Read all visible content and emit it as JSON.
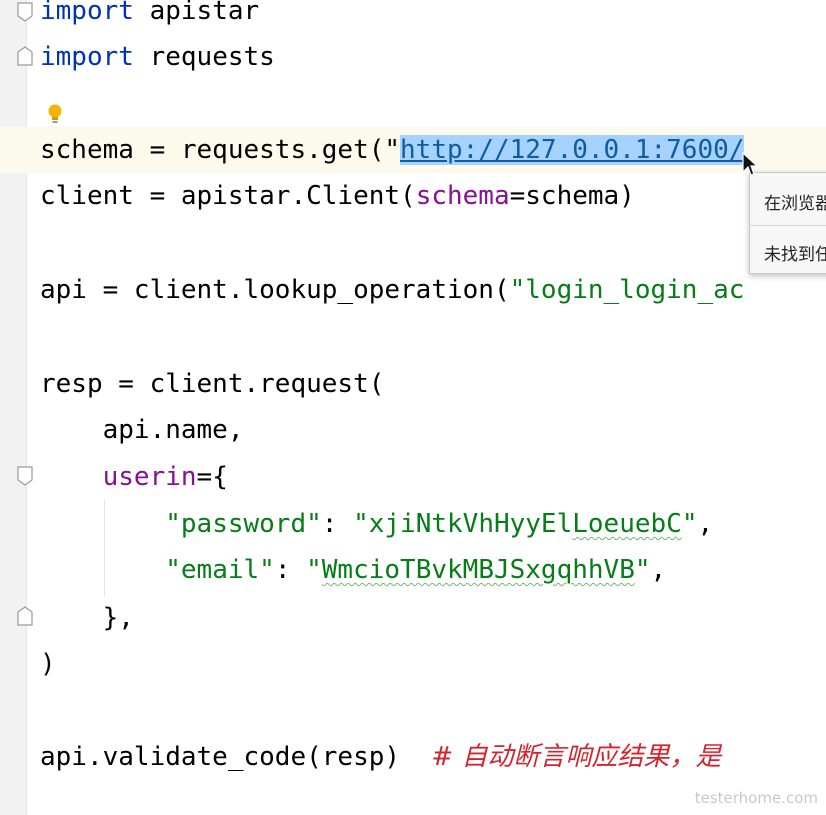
{
  "code": {
    "line1": {
      "kw": "import",
      "rest": " apistar"
    },
    "line2": {
      "kw": "import",
      "rest": " requests"
    },
    "line4": {
      "pre": "schema = requests.get(\"",
      "url": "http://127.0.0.1:7600/"
    },
    "line5": {
      "pre": "client = apistar.Client(",
      "param": "schema",
      "post": "=schema)"
    },
    "line7": {
      "pre": "api = client.lookup_operation(",
      "str": "\"login_login_ac"
    },
    "line9": {
      "text": "resp = client.request("
    },
    "line10": {
      "text": "    api.name,"
    },
    "line11": {
      "indent": "    ",
      "param": "userin",
      "post": "={"
    },
    "line12": {
      "indent": "        ",
      "key": "\"password\"",
      "colon": ": ",
      "val_open": "\"xjiNtkVhHyyEl",
      "val_squig": "LoeuebC",
      "val_close": "\"",
      "trail": ","
    },
    "line13": {
      "indent": "        ",
      "key": "\"email\"",
      "colon": ": ",
      "val_open": "\"",
      "val_squig": "WmcioTBvkMBJSxgqhhVB",
      "val_close": "\"",
      "trail": ","
    },
    "line14": {
      "text": "    },"
    },
    "line15": {
      "text": ")"
    },
    "line17": {
      "pre": "api.validate_code(resp)  ",
      "comment": "# 自动断言响应结果，是"
    }
  },
  "popup": {
    "item1": "在浏览器",
    "item2": "未找到任"
  },
  "watermark": "testerhome.com",
  "colors": {
    "keyword": "#0033b3",
    "string": "#067d17",
    "parameter": "#871094",
    "comment": "#d2252f",
    "selection": "#a6d2ff",
    "current_line": "#fcfaed"
  }
}
